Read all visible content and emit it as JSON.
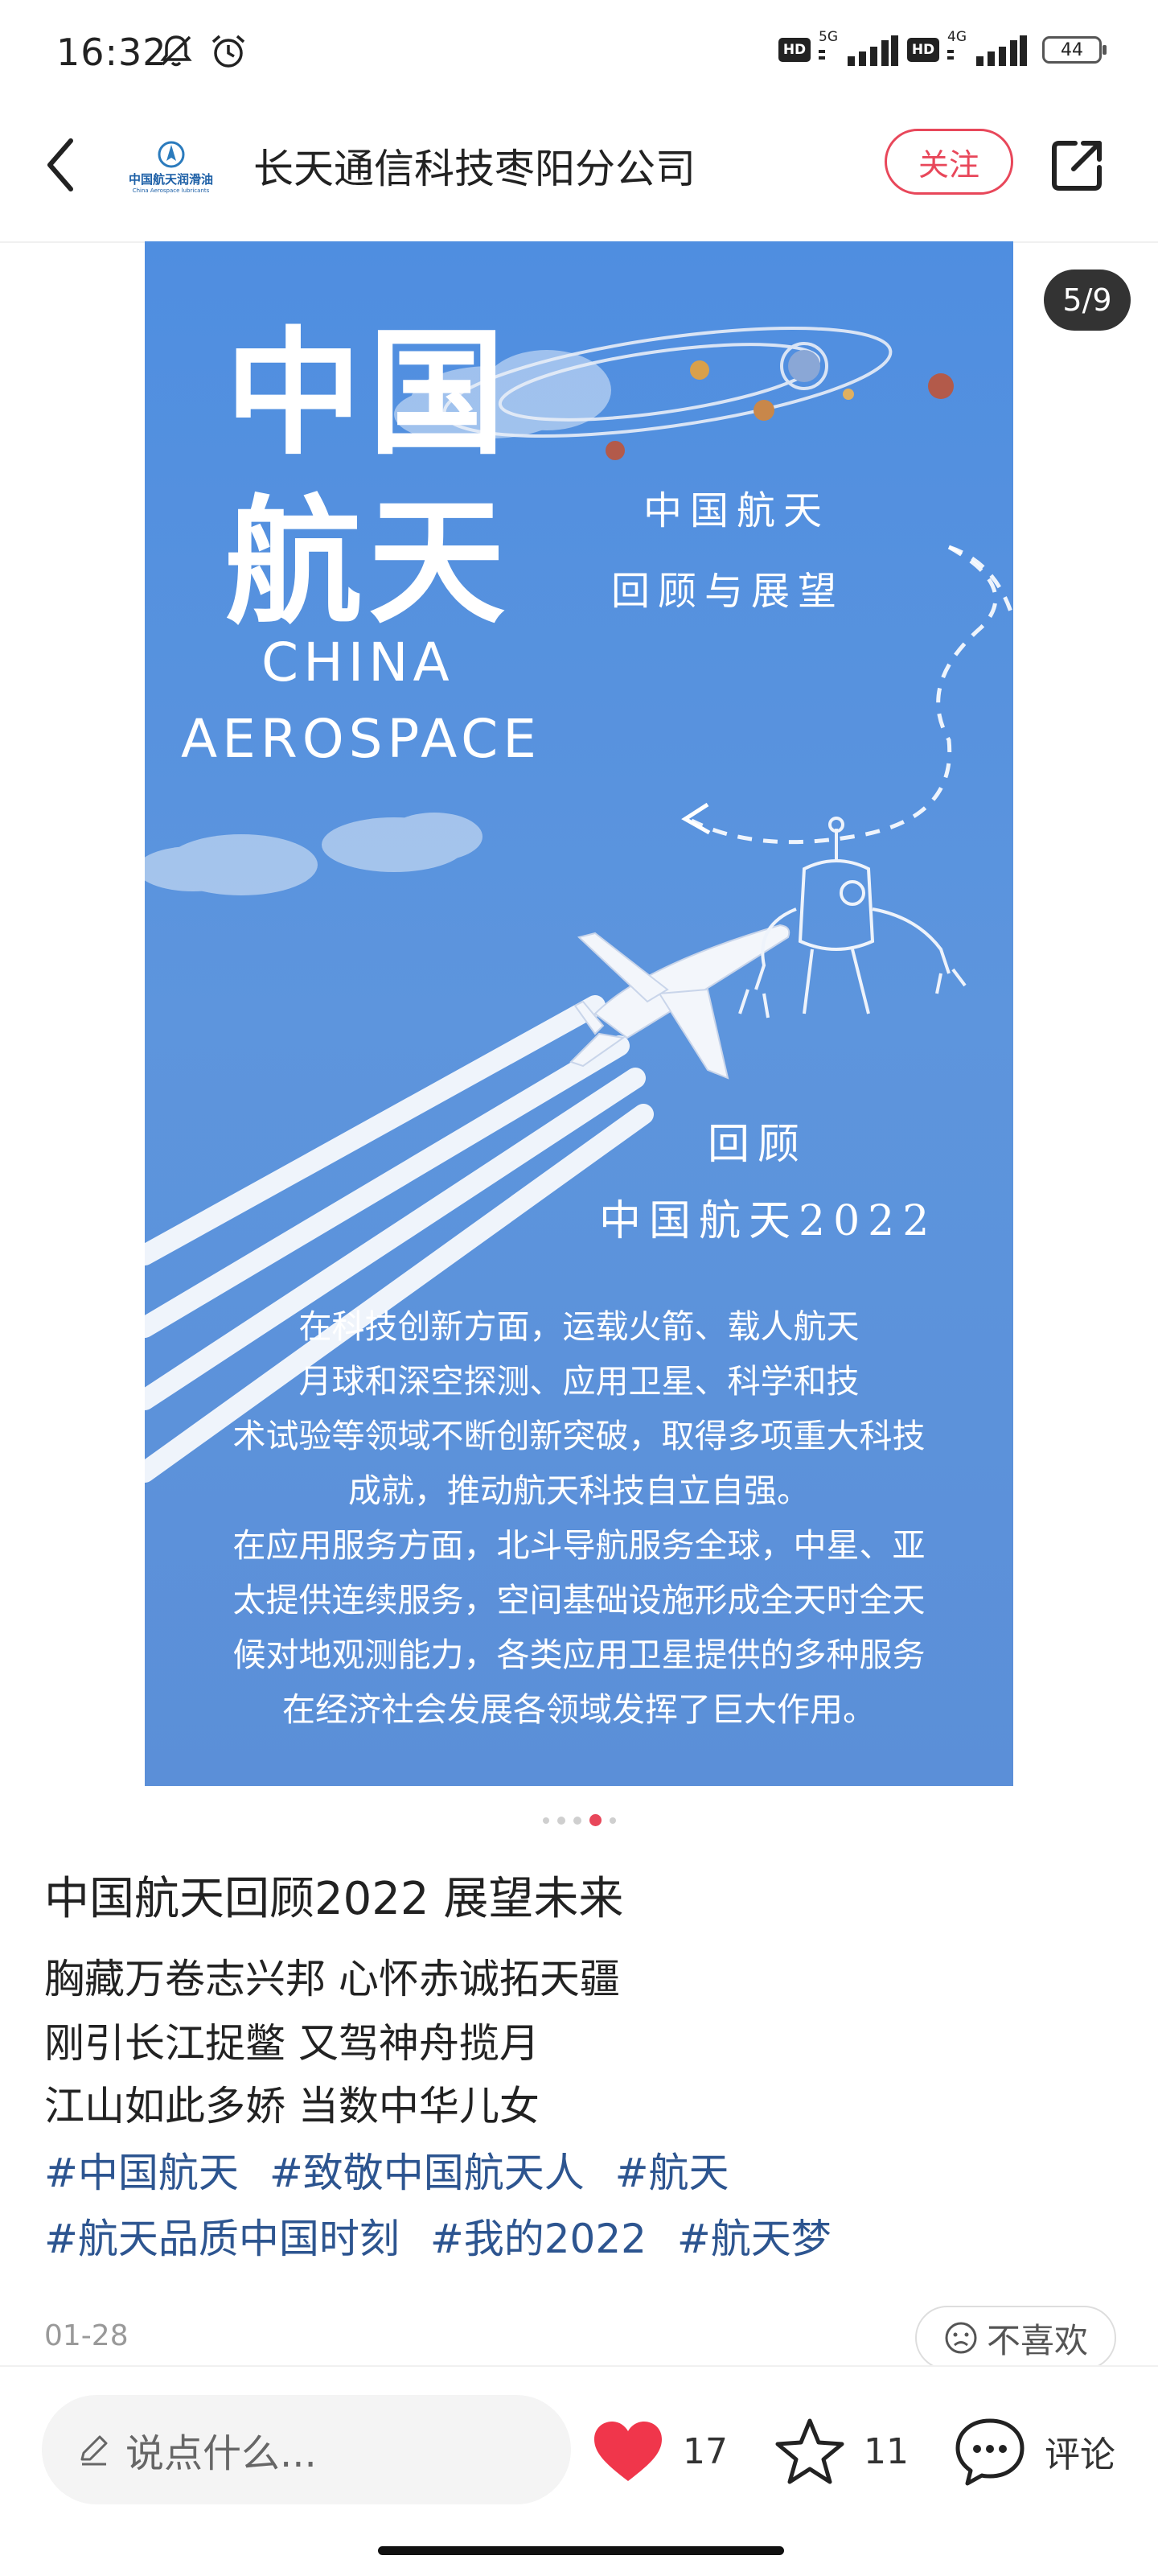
{
  "status_bar": {
    "time": "16:32",
    "network_1": "5G",
    "network_2": "4G",
    "hd": "HD",
    "battery": "44"
  },
  "header": {
    "account_name": "长天通信科技枣阳分公司",
    "follow_label": "关注",
    "logo_line1": "中国航天润滑油",
    "logo_line2": "China Aerospace lubricants"
  },
  "carousel": {
    "counter": "5/9",
    "poster": {
      "title_line1": "中国",
      "title_line2": "航天",
      "en_line1": "CHINA",
      "en_line2": "AEROSPACE",
      "right_line1": "中国航天",
      "right_line2": "回顾与展望",
      "review_line1": "回顾",
      "review_line2": "中国航天2022",
      "body": [
        "在科技创新方面，运载火箭、载人航天",
        "月球和深空探测、应用卫星、科学和技",
        "术试验等领域不断创新突破，取得多项重大科技",
        "成就，推动航天科技自立自强。",
        "在应用服务方面，北斗导航服务全球，中星、亚",
        "太提供连续服务，空间基础设施形成全天时全天",
        "候对地观测能力，各类应用卫星提供的多种服务",
        "在经济社会发展各领域发挥了巨大作用。"
      ]
    }
  },
  "post": {
    "title": "中国航天回顾2022 展望未来",
    "lines": [
      "胸藏万卷志兴邦 心怀赤诚拓天疆",
      "刚引长江捉鳖 又驾神舟揽月",
      "江山如此多娇 当数中华儿女"
    ],
    "tags": [
      "#中国航天",
      "#致敬中国航天人",
      "#航天",
      "#航天品质中国时刻",
      "#我的2022",
      "#航天梦"
    ],
    "date": "01-28",
    "dislike_label": "不喜欢"
  },
  "bottom_bar": {
    "comment_placeholder": "说点什么...",
    "like_count": "17",
    "favorite_count": "11",
    "comment_label": "评论"
  },
  "colors": {
    "accent": "#e8475a",
    "tag": "#2d5590",
    "poster_bg": "#5b8fd8"
  }
}
